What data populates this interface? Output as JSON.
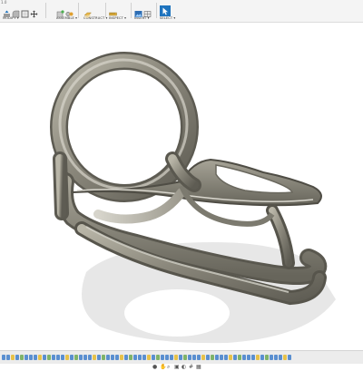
{
  "app": {
    "version_label": "1.0"
  },
  "toolbar": {
    "groups": [
      {
        "id": "modify",
        "label": "MODIFY ▾"
      },
      {
        "id": "assemble",
        "label": "ASSEMBLE ▾"
      },
      {
        "id": "construct",
        "label": "CONSTRUCT ▾"
      },
      {
        "id": "inspect",
        "label": "INSPECT ▾"
      },
      {
        "id": "insert",
        "label": "INSERT ▾"
      },
      {
        "id": "select",
        "label": "SELECT ▾"
      }
    ]
  },
  "colors": {
    "toolbar_bg": "#f4f4f4",
    "accent_blue": "#1e73be",
    "model_metal": "#8c8a7e",
    "shadow": "#e6e6e6",
    "timeline_feature_blue": "#5a8fd0",
    "timeline_feature_yellow": "#e6c24a",
    "timeline_feature_green": "#7fb36a"
  },
  "icons": {
    "modify": [
      "press-pull-icon",
      "fillet-icon",
      "shell-icon",
      "move-icon"
    ],
    "assemble": [
      "new-component-icon",
      "joint-icon"
    ],
    "construct": [
      "offset-plane-icon"
    ],
    "inspect": [
      "measure-icon"
    ],
    "insert": [
      "insert-image-icon",
      "insert-mesh-icon"
    ],
    "select": [
      "select-icon"
    ],
    "navbar": [
      "orbit-icon",
      "pan-icon",
      "zoom-icon",
      "fit-icon",
      "display-settings-icon",
      "grid-icon",
      "viewports-icon"
    ]
  }
}
